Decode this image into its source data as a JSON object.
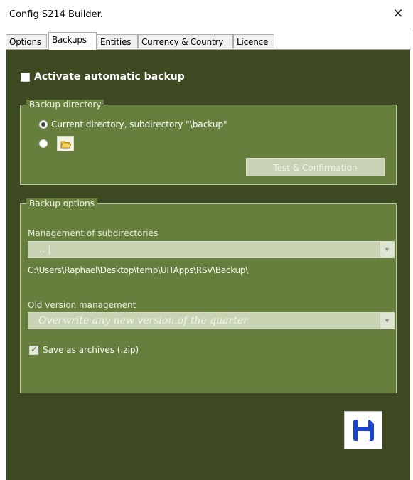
{
  "window": {
    "title": "Config S214 Builder.",
    "close_glyph": "✕"
  },
  "tabs": [
    {
      "label": "Options",
      "active": false
    },
    {
      "label": "Backups",
      "active": true
    },
    {
      "label": "Entities",
      "active": false
    },
    {
      "label": "Currency & Country",
      "active": false
    },
    {
      "label": "Licence",
      "active": false
    }
  ],
  "backups": {
    "activate_label": "Activate automatic backup",
    "activate_checked": false,
    "directory_group": {
      "legend": "Backup directory",
      "option_current": "Current directory, subdirectory \"\\backup\"",
      "option_current_selected": true,
      "option_custom_selected": false,
      "folder_icon": "folder-open-icon",
      "test_button": "Test & Confirmation"
    },
    "options_group": {
      "legend": "Backup options",
      "subdir_label": "Management of subdirectories",
      "subdir_value": ".. |",
      "path_text": "C:\\Users\\Raphael\\Desktop\\temp\\UITApps\\RSV\\Backup\\",
      "version_label": "Old version management",
      "version_value": "Overwrite any new version of the quarter",
      "zip_label": "Save as archives (.zip)",
      "zip_checked": true
    },
    "save_icon": "floppy-disk-icon"
  },
  "colors": {
    "page_background": "#3d4a22",
    "group_background": "#667f3d",
    "save_icon_blue": "#1b45c8"
  }
}
